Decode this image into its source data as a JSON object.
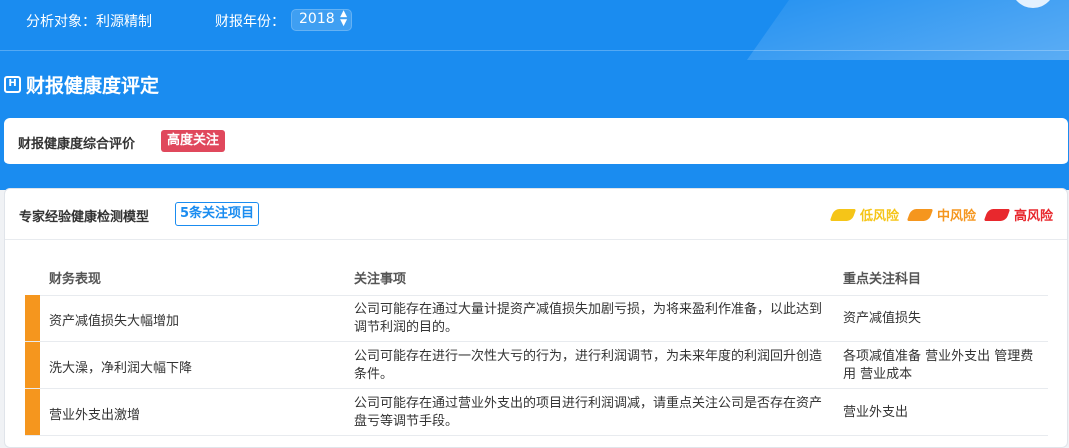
{
  "header": {
    "analysis_target_label": "分析对象：利源精制",
    "year_label": "财报年份：",
    "year_value": "2018",
    "year_arrows": "▲▼"
  },
  "section": {
    "title": "财报健康度评定",
    "icon": "H-square-icon",
    "icon_glyph": "H"
  },
  "overall": {
    "label": "财报健康度综合评价",
    "rating": "高度关注",
    "rating_color": "#e0485c"
  },
  "expert_model": {
    "label": "专家经验健康检测模型",
    "count_badge": "5条关注项目",
    "legend": [
      {
        "label": "低风险",
        "color": "#f5c518"
      },
      {
        "label": "中风险",
        "color": "#f5961e"
      },
      {
        "label": "高风险",
        "color": "#e8282d"
      }
    ],
    "columns": [
      "财务表现",
      "关注事项",
      "重点关注科目"
    ],
    "rows": [
      {
        "performance": "资产减值损失大幅增加",
        "concern": "公司可能存在通过大量计提资产减值损失加剧亏损，为将来盈利作准备，以此达到调节利润的目的。",
        "subjects": "资产减值损失",
        "risk": "中风险",
        "risk_color": "#f5961e"
      },
      {
        "performance": "洗大澡，净利润大幅下降",
        "concern": "公司可能存在进行一次性大亏的行为，进行利润调节，为未来年度的利润回升创造条件。",
        "subjects": "各项减值准备 营业外支出 管理费用 营业成本",
        "risk": "中风险",
        "risk_color": "#f5961e"
      },
      {
        "performance": "营业外支出激增",
        "concern": "公司可能存在通过营业外支出的项目进行利润调减，请重点关注公司是否存在资产盘亏等调节手段。",
        "subjects": "营业外支出",
        "risk": "中风险",
        "risk_color": "#f5961e"
      }
    ]
  },
  "theme": {
    "primary_blue": "#1a8cf0"
  }
}
